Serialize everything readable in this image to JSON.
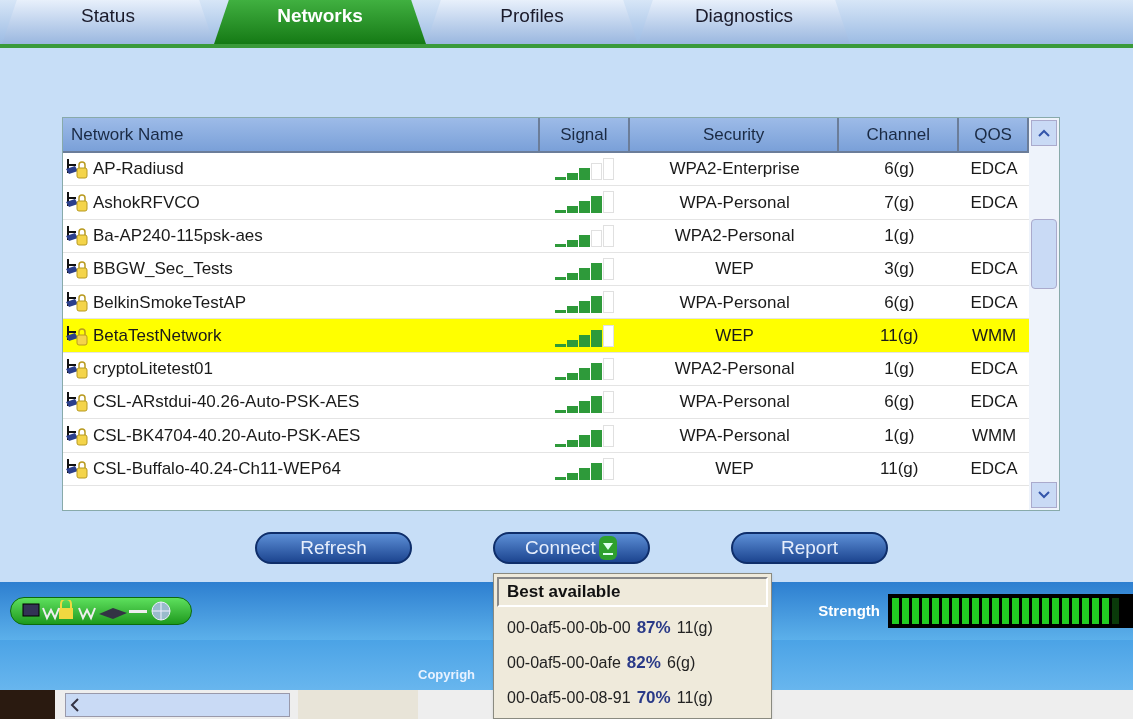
{
  "tabs": [
    {
      "label": "Status",
      "selected": false
    },
    {
      "label": "Networks",
      "selected": true
    },
    {
      "label": "Profiles",
      "selected": false
    },
    {
      "label": "Diagnostics",
      "selected": false
    }
  ],
  "table": {
    "columns": [
      "Network Name",
      "Signal",
      "Security",
      "Channel",
      "QOS"
    ],
    "rows": [
      {
        "name": "AP-Radiusd",
        "signal": {
          "level": 0.6
        },
        "security": "WPA2-Enterprise",
        "channel": "6(g)",
        "qos": "EDCA",
        "selected": false
      },
      {
        "name": "AshokRFVCO",
        "signal": {
          "level": 0.8
        },
        "security": "WPA-Personal",
        "channel": "7(g)",
        "qos": "EDCA",
        "selected": false
      },
      {
        "name": "Ba-AP240-115psk-aes",
        "signal": {
          "level": 0.6
        },
        "security": "WPA2-Personal",
        "channel": "1(g)",
        "selected": false
      },
      {
        "name": "BBGW_Sec_Tests",
        "signal": {
          "level": 0.8
        },
        "security": "WEP",
        "channel": "3(g)",
        "qos": "EDCA",
        "selected": false
      },
      {
        "name": "BelkinSmokeTestAP",
        "signal": {
          "level": 0.8
        },
        "security": "WPA-Personal",
        "channel": "6(g)",
        "qos": "EDCA",
        "selected": false
      },
      {
        "name": "BetaTestNetwork",
        "signal": {
          "level": 0.8
        },
        "security": "WEP",
        "channel": "11(g)",
        "qos": "WMM",
        "selected": true
      },
      {
        "name": "cryptoLitetest01",
        "signal": {
          "level": 0.8
        },
        "security": "WPA2-Personal",
        "channel": "1(g)",
        "qos": "EDCA",
        "selected": false
      },
      {
        "name": "CSL-ARstdui-40.26-Auto-PSK-AES",
        "signal": {
          "level": 0.8
        },
        "security": "WPA-Personal",
        "channel": "6(g)",
        "qos": "EDCA",
        "selected": false
      },
      {
        "name": "CSL-BK4704-40.20-Auto-PSK-AES",
        "signal": {
          "level": 0.8
        },
        "security": "WPA-Personal",
        "channel": "1(g)",
        "qos": "WMM",
        "selected": false
      },
      {
        "name": "CSL-Buffalo-40.24-Ch11-WEP64",
        "signal": {
          "level": 0.8
        },
        "security": "WEP",
        "channel": "11(g)",
        "qos": "EDCA",
        "selected": false
      }
    ]
  },
  "buttons": [
    "Refresh",
    "Connect",
    "Report"
  ],
  "connect_menu": {
    "items": [
      {
        "kind": "header",
        "label": "Best available",
        "selected": true
      },
      {
        "kind": "entry",
        "mac": "00-0af5-00-0b-00",
        "percent": "87%",
        "channel": "11(g)",
        "selected": false
      },
      {
        "kind": "entry",
        "mac": "00-0af5-00-0afe",
        "percent": "82%",
        "channel": "6(g)",
        "selected": false
      },
      {
        "kind": "entry",
        "mac": "00-0af5-00-08-91",
        "percent": "70%",
        "channel": "11(g)",
        "selected": false
      }
    ]
  },
  "status": {
    "strength_label": "Strength",
    "strength": {
      "level": 0.96
    },
    "copyright": "Copyrigh"
  }
}
